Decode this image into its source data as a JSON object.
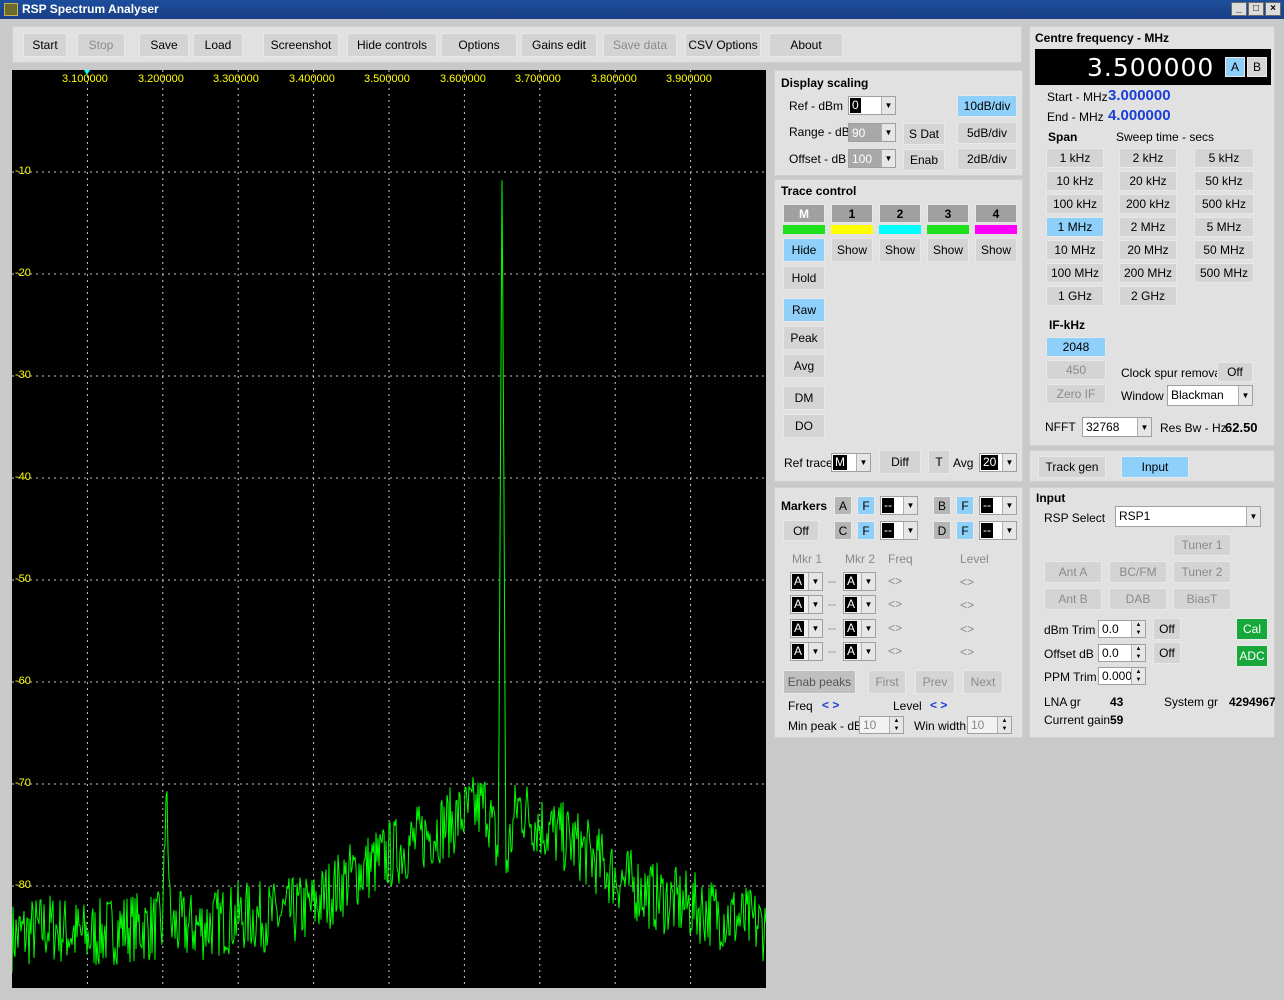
{
  "window": {
    "title": "RSP Spectrum Analyser"
  },
  "toolbar": {
    "start": "Start",
    "stop": "Stop",
    "save": "Save",
    "load": "Load",
    "screenshot": "Screenshot",
    "hide_controls": "Hide controls",
    "options": "Options",
    "gains_edit": "Gains edit",
    "save_data": "Save data",
    "csv_options": "CSV Options",
    "about": "About"
  },
  "plot": {
    "x_ticks": [
      "3.100000",
      "3.200000",
      "3.300000",
      "3.400000",
      "3.500000",
      "3.600000",
      "3.700000",
      "3.800000",
      "3.900000"
    ],
    "y_ticks": [
      "-10",
      "-20",
      "-30",
      "-40",
      "-50",
      "-60",
      "-70",
      "-80"
    ],
    "colors": {
      "background": "#000000",
      "trace": "#00ff00",
      "grid": "#c8c8c8",
      "labels": "#ffff00"
    }
  },
  "chart_data": {
    "type": "line",
    "xlim": [
      3.0,
      4.0
    ],
    "ylim": [
      -100,
      0
    ],
    "x_unit": "MHz",
    "y_unit": "dBm",
    "grid": true,
    "series": [
      {
        "points": [
          [
            3.0,
            -85
          ],
          [
            3.05,
            -84
          ],
          [
            3.1,
            -85
          ],
          [
            3.15,
            -84
          ],
          [
            3.2,
            -84
          ],
          [
            3.205,
            -69
          ],
          [
            3.21,
            -84
          ],
          [
            3.25,
            -84
          ],
          [
            3.3,
            -83
          ],
          [
            3.35,
            -83
          ],
          [
            3.4,
            -82
          ],
          [
            3.45,
            -79
          ],
          [
            3.5,
            -77
          ],
          [
            3.55,
            -75
          ],
          [
            3.6,
            -73
          ],
          [
            3.63,
            -72
          ],
          [
            3.645,
            -77
          ],
          [
            3.65,
            -9
          ],
          [
            3.655,
            -78
          ],
          [
            3.67,
            -72
          ],
          [
            3.7,
            -74
          ],
          [
            3.75,
            -76
          ],
          [
            3.8,
            -79
          ],
          [
            3.85,
            -81
          ],
          [
            3.9,
            -82
          ],
          [
            3.95,
            -83
          ],
          [
            4.0,
            -84
          ]
        ]
      }
    ]
  },
  "display_scaling": {
    "title": "Display scaling",
    "ref_label": "Ref - dBm",
    "ref_value": "0",
    "range_label": "Range - dB",
    "range_value": "90",
    "offset_label": "Offset - dB",
    "offset_value": "100",
    "s_dat": "S Dat",
    "enab": "Enab",
    "div10": "10dB/div",
    "div5": "5dB/div",
    "div2": "2dB/div"
  },
  "trace_control": {
    "title": "Trace control",
    "traces": [
      {
        "label": "M",
        "color": "#1ee11e",
        "btn": "Hide"
      },
      {
        "label": "1",
        "color": "#ffff00",
        "btn": "Show"
      },
      {
        "label": "2",
        "color": "#00ffff",
        "btn": "Show"
      },
      {
        "label": "3",
        "color": "#1ee11e",
        "btn": "Show"
      },
      {
        "label": "4",
        "color": "#ff00ff",
        "btn": "Show"
      }
    ],
    "hold": "Hold",
    "raw": "Raw",
    "peak": "Peak",
    "avg": "Avg",
    "dm": "DM",
    "do": "DO",
    "ref_trace_label": "Ref trace",
    "ref_trace_value": "M",
    "diff": "Diff",
    "t": "T",
    "avg_label": "Avg",
    "avg_value": "20"
  },
  "markers": {
    "title": "Markers",
    "a": "A",
    "b": "B",
    "c": "C",
    "d": "D",
    "f": "F",
    "dash": "--",
    "off": "Off",
    "mkr1": "Mkr 1",
    "mkr2": "Mkr 2",
    "freq": "Freq",
    "level": "Level",
    "rows": [
      {
        "m1": "A",
        "sep": "--",
        "m2": "A",
        "freq": "<>",
        "level": "<>"
      },
      {
        "m1": "A",
        "sep": "--",
        "m2": "A",
        "freq": "<>",
        "level": "<>"
      },
      {
        "m1": "A",
        "sep": "--",
        "m2": "A",
        "freq": "<>",
        "level": "<>"
      },
      {
        "m1": "A",
        "sep": "--",
        "m2": "A",
        "freq": "<>",
        "level": "<>"
      }
    ],
    "enab_peaks": "Enab peaks",
    "first": "First",
    "prev": "Prev",
    "next": "Next",
    "freq_label": "Freq",
    "freq_arrows": "< >",
    "level_label": "Level",
    "level_arrows": "< >",
    "min_peak_label": "Min peak - dB",
    "min_peak_value": "10",
    "win_width_label": "Win width",
    "win_width_value": "10"
  },
  "frequency": {
    "title": "Centre  frequency - MHz",
    "centre": "3.500000",
    "a": "A",
    "b": "B",
    "start_label": "Start - MHz",
    "start_value": "3.000000",
    "end_label": "End - MHz",
    "end_value": "4.000000",
    "span_label": "Span",
    "sweep_label": "Sweep time - secs",
    "span_col1": [
      "1 kHz",
      "10 kHz",
      "100 kHz",
      "1 MHz",
      "10 MHz",
      "100 MHz",
      "1 GHz"
    ],
    "span_col2": [
      "2 kHz",
      "20 kHz",
      "200 kHz",
      "2 MHz",
      "20 MHz",
      "200 MHz",
      "2 GHz"
    ],
    "span_col3": [
      "5 kHz",
      "50 kHz",
      "500 kHz",
      "5 MHz",
      "50 MHz",
      "500 MHz"
    ],
    "if_label": "IF-kHz",
    "if_2048": "2048",
    "if_450": "450",
    "zero_if": "Zero IF",
    "clock_spur_label": "Clock spur removal",
    "clock_spur_value": "Off",
    "window_label": "Window",
    "window_value": "Blackman",
    "nfft_label": "NFFT",
    "nfft_value": "32768",
    "res_bw_label": "Res Bw - Hz",
    "res_bw_value": "62.50"
  },
  "mode": {
    "track_gen": "Track gen",
    "input": "Input"
  },
  "input": {
    "title": "Input",
    "rsp_select_label": "RSP Select",
    "rsp_select_value": "RSP1",
    "tuner1": "Tuner 1",
    "tuner2": "Tuner 2",
    "ant_a": "Ant A",
    "ant_b": "Ant B",
    "bcfm": "BC/FM",
    "dab": "DAB",
    "biast": "BiasT",
    "dbm_trim_label": "dBm Trim",
    "dbm_trim_value": "0.0",
    "dbm_trim_off": "Off",
    "offset_label": "Offset dB",
    "offset_value": "0.0",
    "offset_off": "Off",
    "ppm_label": "PPM Trim",
    "ppm_value": "0.000",
    "cal": "Cal",
    "adc": "ADC",
    "lna_label": "LNA gr",
    "lna_value": "43",
    "system_label": "System gr",
    "system_value": "4294967",
    "current_label": "Current gain",
    "current_value": "59"
  }
}
